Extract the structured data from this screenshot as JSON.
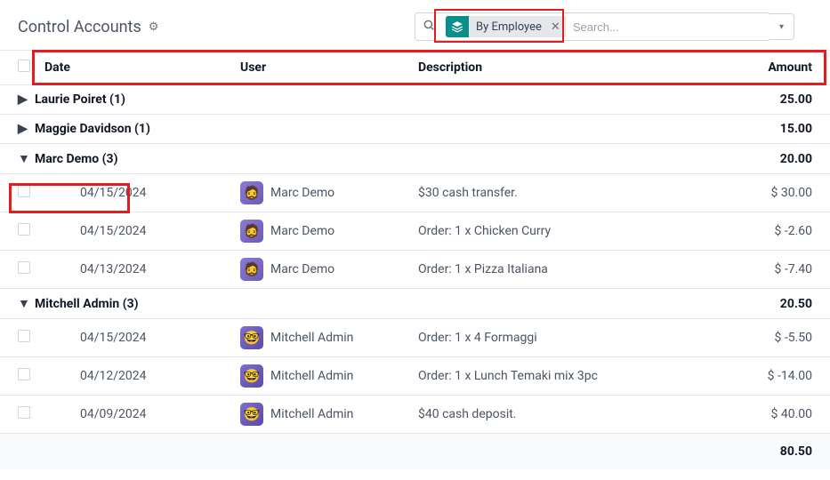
{
  "header": {
    "title": "Control Accounts"
  },
  "search": {
    "chip_label": "By Employee",
    "placeholder": "Search..."
  },
  "columns": {
    "date": "Date",
    "user": "User",
    "description": "Description",
    "amount": "Amount"
  },
  "groups": [
    {
      "name": "Laurie Poiret",
      "count": "(1)",
      "expanded": false,
      "subtotal": "25.00"
    },
    {
      "name": "Maggie Davidson",
      "count": "(1)",
      "expanded": false,
      "subtotal": "15.00"
    },
    {
      "name": "Marc Demo",
      "count": "(3)",
      "expanded": true,
      "subtotal": "20.00",
      "rows": [
        {
          "date": "04/15/2024",
          "user": "Marc Demo",
          "desc": "$30 cash transfer.",
          "amount": "$ 30.00",
          "avatar": "marc"
        },
        {
          "date": "04/15/2024",
          "user": "Marc Demo",
          "desc": "Order: 1 x Chicken Curry",
          "amount": "$ -2.60",
          "avatar": "marc"
        },
        {
          "date": "04/13/2024",
          "user": "Marc Demo",
          "desc": "Order: 1 x Pizza Italiana",
          "amount": "$ -7.40",
          "avatar": "marc"
        }
      ]
    },
    {
      "name": "Mitchell Admin",
      "count": "(3)",
      "expanded": true,
      "subtotal": "20.50",
      "rows": [
        {
          "date": "04/15/2024",
          "user": "Mitchell Admin",
          "desc": "Order: 1 x 4 Formaggi",
          "amount": "$ -5.50",
          "avatar": "mitch"
        },
        {
          "date": "04/12/2024",
          "user": "Mitchell Admin",
          "desc": "Order: 1 x Lunch Temaki mix 3pc",
          "amount": "$ -14.00",
          "avatar": "mitch"
        },
        {
          "date": "04/09/2024",
          "user": "Mitchell Admin",
          "desc": "$40 cash deposit.",
          "amount": "$ 40.00",
          "avatar": "mitch"
        }
      ]
    }
  ],
  "total": "80.50"
}
